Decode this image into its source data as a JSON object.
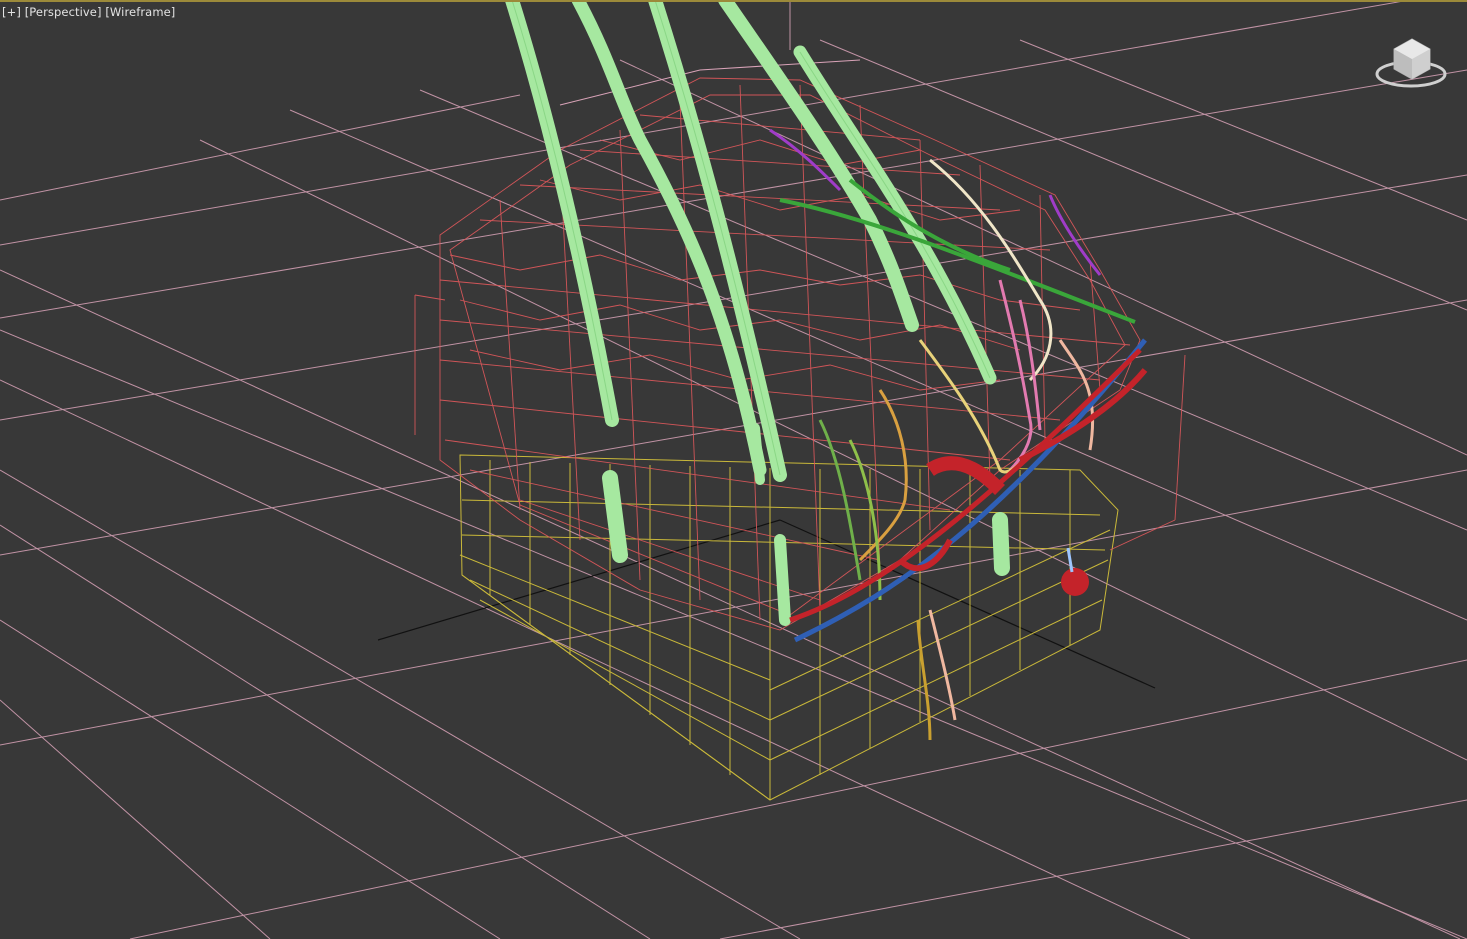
{
  "viewport": {
    "menu_plus": "[+]",
    "view_mode": "[Perspective]",
    "shading_mode": "[Wireframe]"
  },
  "viewcube": {
    "icon": "viewcube-icon"
  },
  "colors": {
    "background": "#383838",
    "grid": "#d9a3b8",
    "skin_mesh": "#d9575a",
    "lattice": "#c9b83a",
    "hair_strand": "#a6e8a0",
    "vein": "#2f5fb5",
    "artery": "#c4232a",
    "nerve_yellow": "#e8d27a",
    "nerve_pink": "#e27ab0",
    "purple_fiber": "#a03cc8",
    "green_fiber": "#3aa63a"
  }
}
